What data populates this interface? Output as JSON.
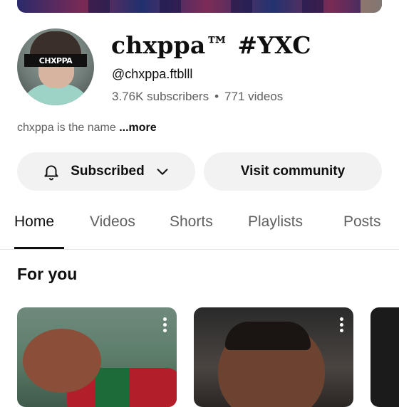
{
  "channel": {
    "name": "chxppa™ #YXC",
    "handle": "@chxppa.ftblll",
    "subscribers": "3.76K subscribers",
    "separator": "•",
    "videos": "771 videos",
    "description": "chxppa is the name ",
    "more_label": "...more",
    "avatar_text": "CHXPPA"
  },
  "buttons": {
    "subscribed_label": "Subscribed",
    "visit_community_label": "Visit community"
  },
  "tabs": [
    {
      "label": "Home",
      "active": true
    },
    {
      "label": "Videos",
      "active": false
    },
    {
      "label": "Shorts",
      "active": false
    },
    {
      "label": "Playlists",
      "active": false
    },
    {
      "label": "Posts",
      "active": false
    }
  ],
  "section": {
    "title": "For you"
  },
  "icons": {
    "bell": "bell-icon",
    "chevron": "chevron-down-icon",
    "more": "more-vertical-icon"
  }
}
